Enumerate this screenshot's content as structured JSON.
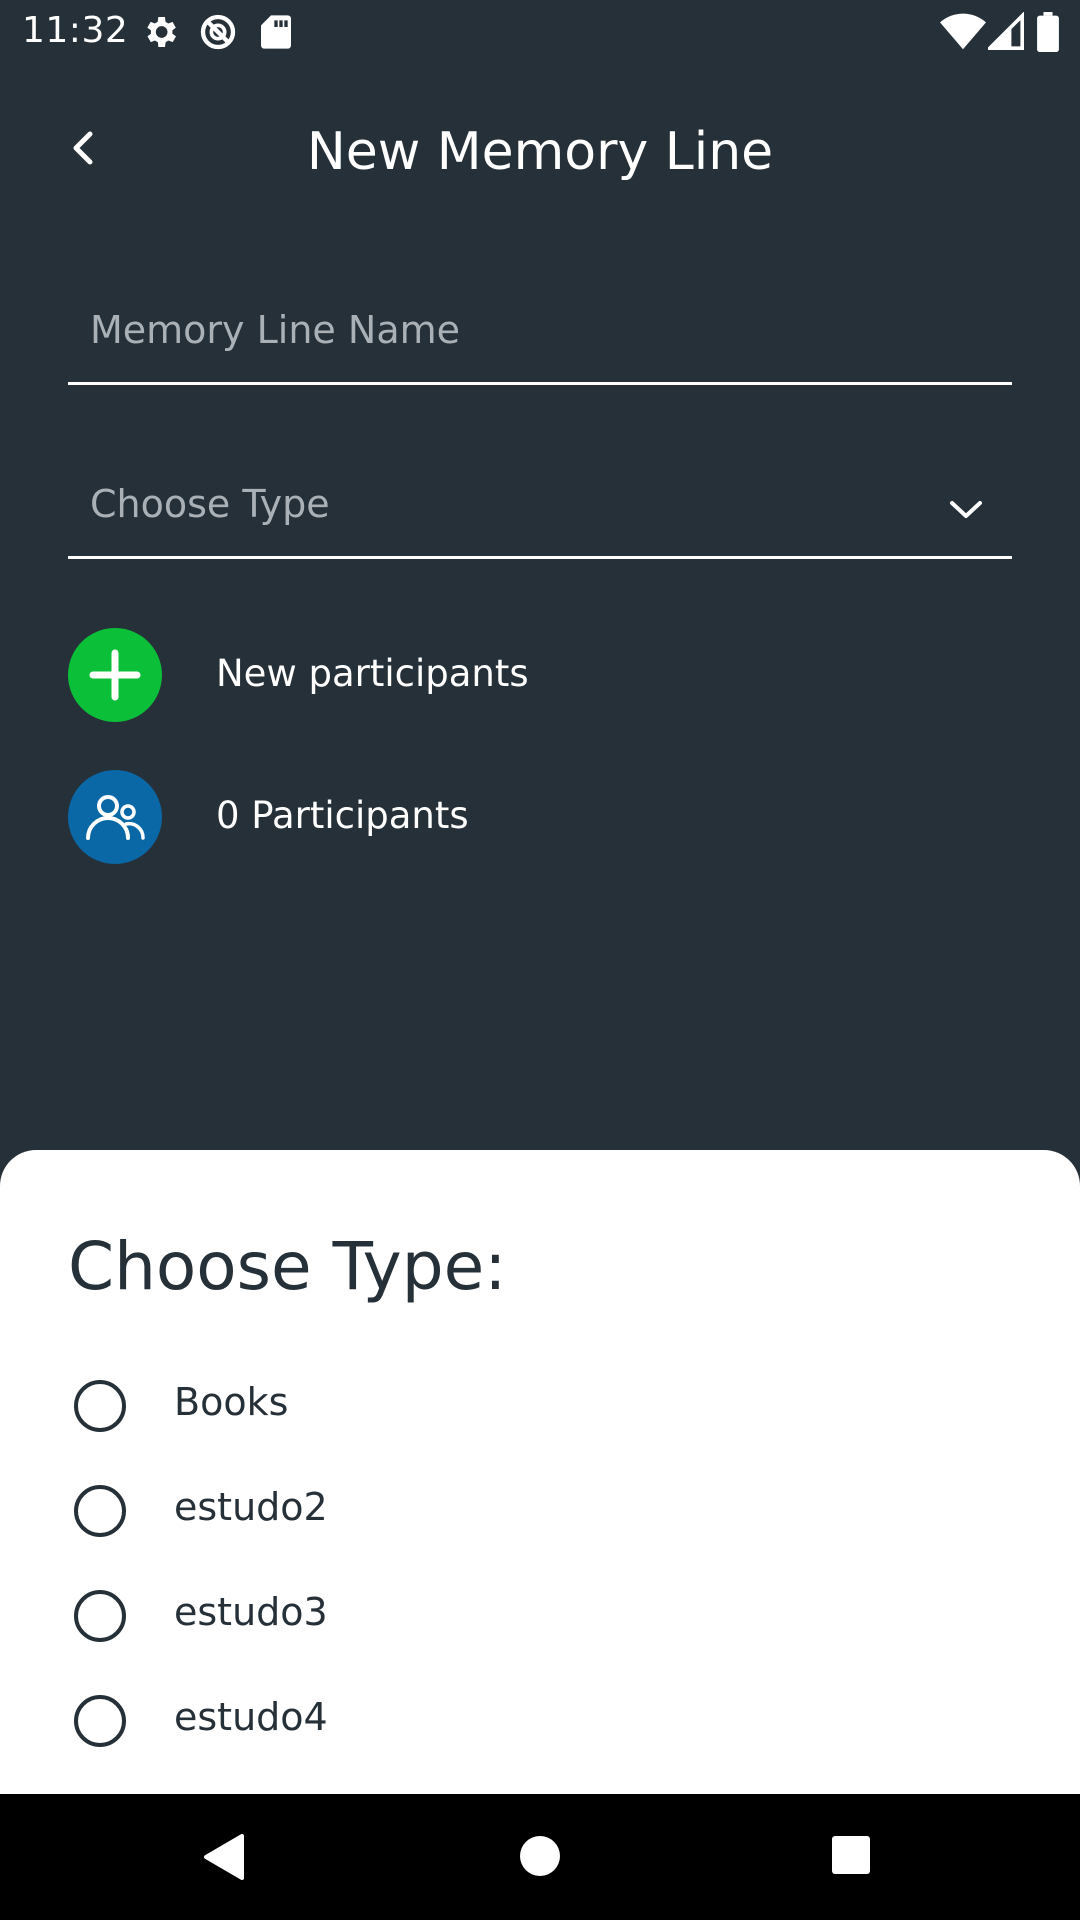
{
  "status_bar": {
    "time": "11:32",
    "icons_left": [
      "gear-icon",
      "do-not-disturb-icon",
      "sd-card-icon"
    ],
    "icons_right": [
      "wifi-icon",
      "signal-icon",
      "battery-icon"
    ]
  },
  "app_bar": {
    "title": "New Memory Line",
    "back_icon": "back-chevron-icon"
  },
  "form": {
    "name_placeholder": "Memory Line Name",
    "type_placeholder": "Choose Type",
    "dropdown_icon": "chevron-down-icon"
  },
  "participants": {
    "new_label": "New participants",
    "count_label": "0 Participants",
    "new_icon": "plus-icon",
    "count_icon": "people-icon"
  },
  "sheet": {
    "title": "Choose Type:",
    "options": [
      {
        "label": "Books",
        "selected": false
      },
      {
        "label": "estudo2",
        "selected": false
      },
      {
        "label": "estudo3",
        "selected": false
      },
      {
        "label": "estudo4",
        "selected": false
      }
    ]
  },
  "nav_bar": {
    "buttons": [
      "back-triangle-icon",
      "home-circle-icon",
      "recents-square-icon"
    ]
  },
  "colors": {
    "background": "#263038",
    "accent_green": "#0cbf38",
    "accent_blue": "#0a68a6",
    "sheet_bg": "#ffffff",
    "placeholder": "#a9b1b7"
  }
}
